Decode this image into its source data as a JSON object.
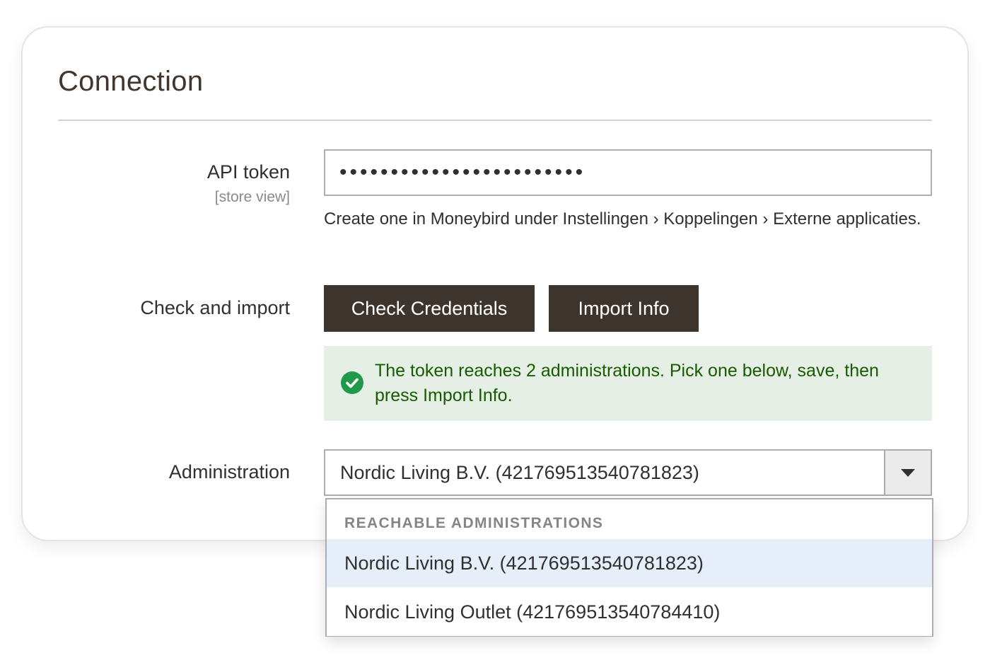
{
  "section": {
    "title": "Connection"
  },
  "api_token": {
    "label": "API token",
    "scope": "[store view]",
    "value": "••••••••••••••••••••••••",
    "note": "Create one in Moneybird under Instellingen › Koppelingen › Externe applicaties."
  },
  "check_import": {
    "label": "Check and import",
    "check_button": "Check Credentials",
    "import_button": "Import Info",
    "message": "The token reaches 2 administrations. Pick one below, save, then press Import Info.",
    "message_icon": "check-circle-icon",
    "message_color": "#185b00"
  },
  "administration": {
    "label": "Administration",
    "selected": "Nordic Living B.V. (421769513540781823)",
    "dropdown_header": "REACHABLE ADMINISTRATIONS",
    "options": [
      "Nordic Living B.V. (421769513540781823)",
      "Nordic Living Outlet (421769513540784410)"
    ]
  },
  "colors": {
    "button_bg": "#3d342e",
    "success_bg": "#e5efe5",
    "success_icon": "#1f9a4c",
    "highlight_option": "#e6eef9"
  }
}
